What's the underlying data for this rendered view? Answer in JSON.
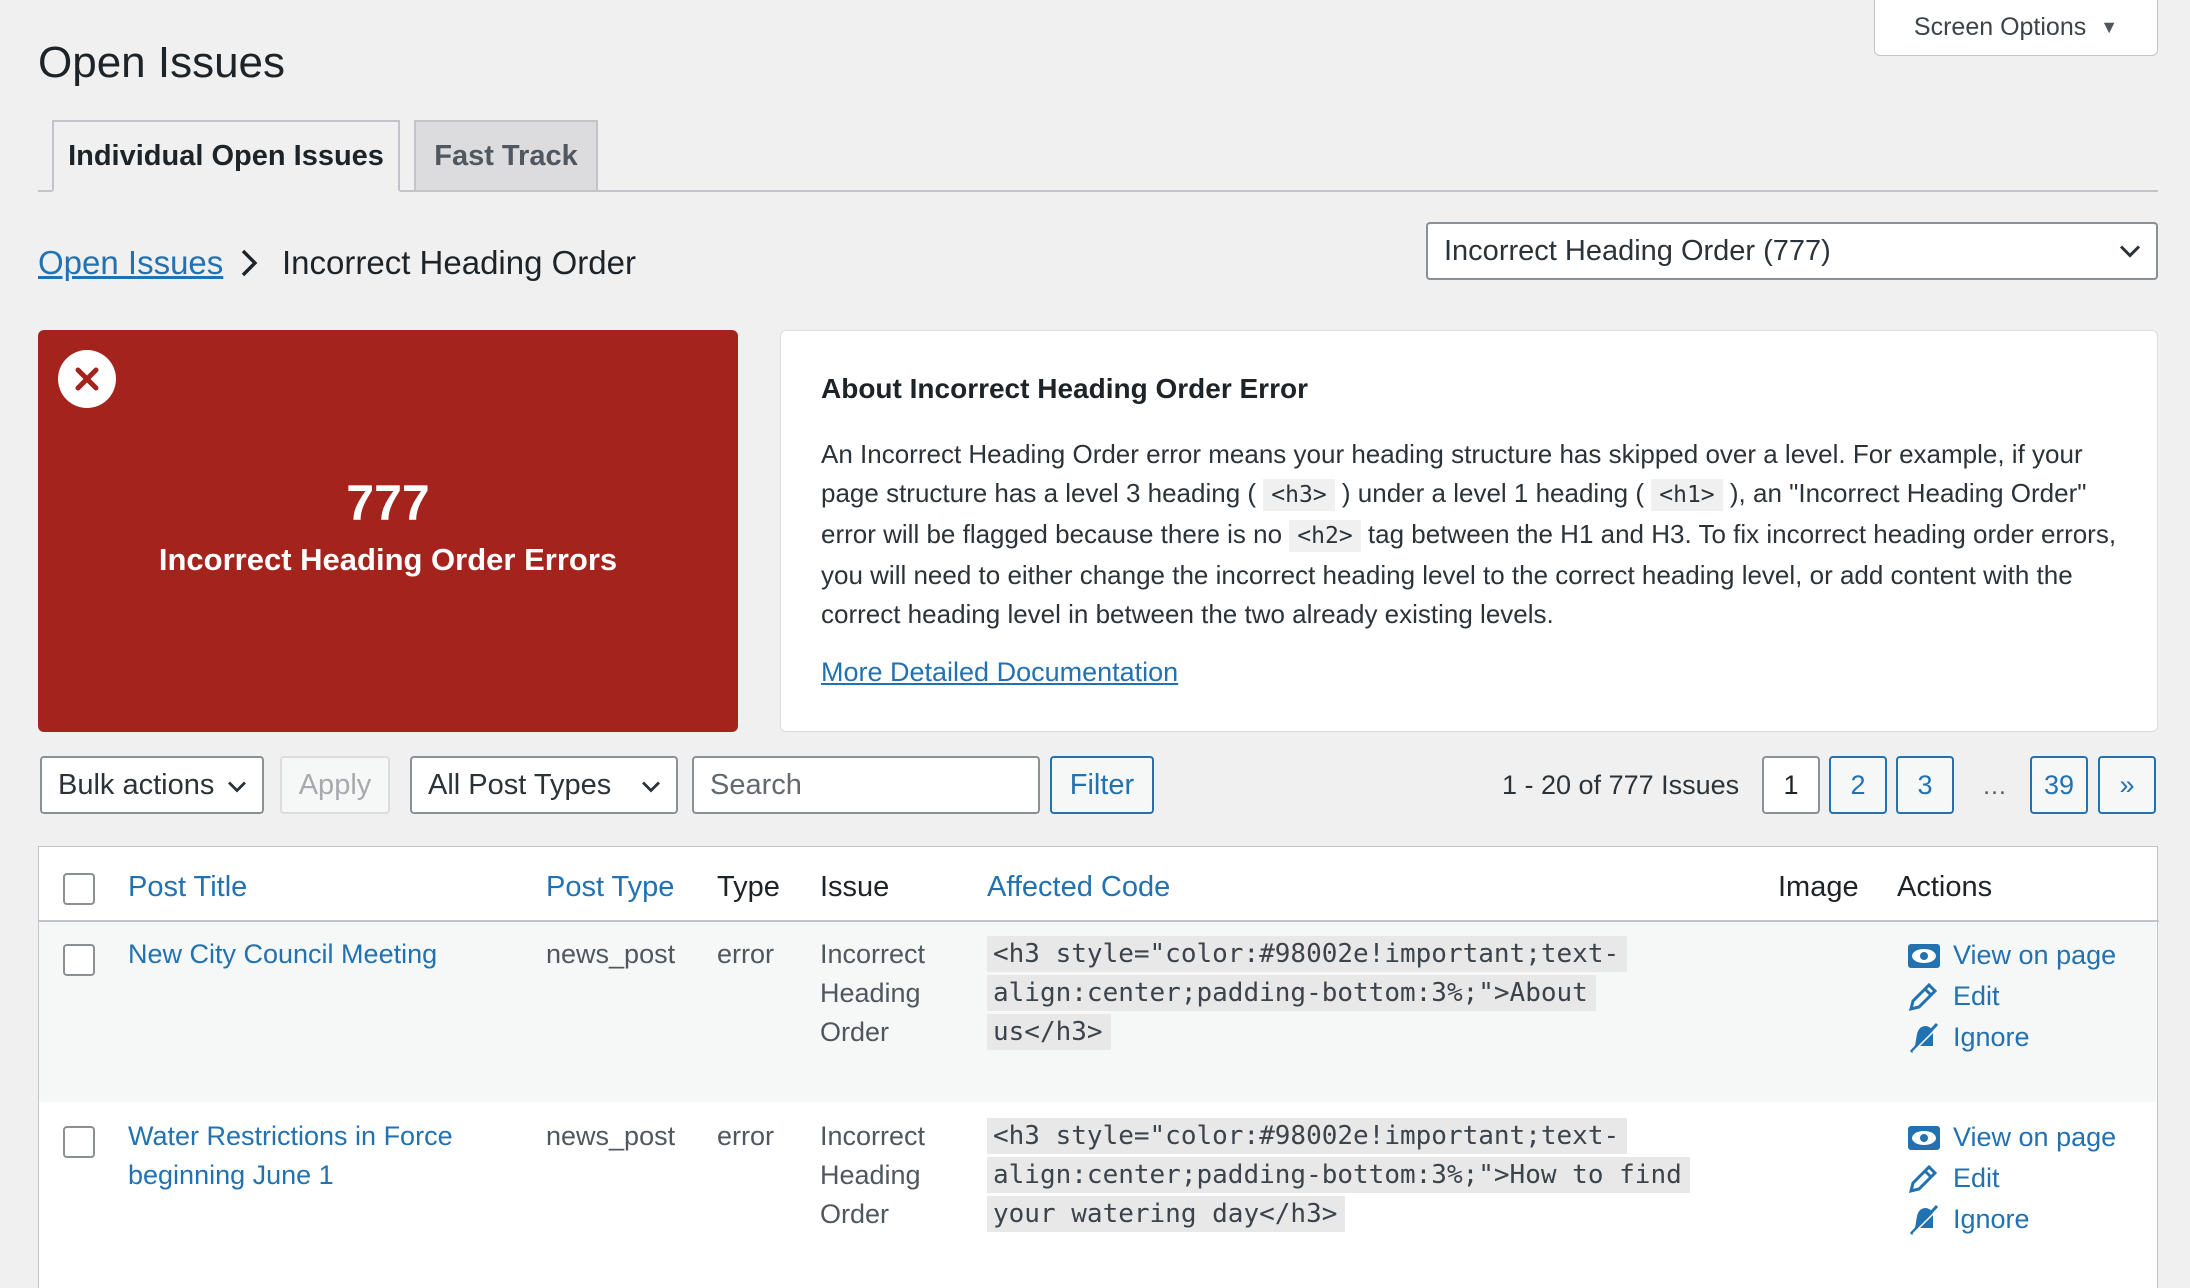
{
  "screen_options": {
    "label": "Screen Options"
  },
  "page": {
    "title": "Open Issues"
  },
  "tabs": [
    {
      "label": "Individual Open Issues",
      "active": true
    },
    {
      "label": "Fast Track",
      "active": false
    }
  ],
  "breadcrumb": {
    "parent": "Open Issues",
    "current": "Incorrect Heading Order"
  },
  "issue_select": {
    "value": "Incorrect Heading Order (777)"
  },
  "summary": {
    "count": "777",
    "label": "Incorrect Heading Order Errors",
    "color": "#a5231d"
  },
  "about": {
    "title": "About Incorrect Heading Order Error",
    "p1": "An Incorrect Heading Order error means your heading structure has skipped over a level. For example, if your page structure has a level 3 heading (",
    "code1": "<h3>",
    "p2": ") under a level 1 heading (",
    "code2": "<h1>",
    "p3": "), an \"Incorrect Heading Order\" error will be flagged because there is no",
    "code3": "<h2>",
    "p4": "tag between the H1 and H3. To fix incorrect heading order errors, you will need to either change the incorrect heading level to the correct heading level, or add content with the correct heading level in between the two already existing levels.",
    "link": "More Detailed Documentation"
  },
  "toolbar": {
    "bulk_actions": "Bulk actions",
    "apply": "Apply",
    "post_types": "All Post Types",
    "search_placeholder": "Search",
    "filter": "Filter",
    "range": "1 - 20 of 777 Issues"
  },
  "pagination": {
    "p1": "1",
    "p2": "2",
    "p3": "3",
    "ellipsis": "…",
    "last": "39",
    "next": "»"
  },
  "table": {
    "headers": {
      "post_title": "Post Title",
      "post_type": "Post Type",
      "type": "Type",
      "issue": "Issue",
      "affected_code": "Affected Code",
      "image": "Image",
      "actions": "Actions"
    },
    "rows": [
      {
        "title": "New City Council Meeting",
        "post_type": "news_post",
        "type": "error",
        "issue": "Incorrect Heading Order",
        "code": "<h3 style=\"color:#98002e!important;text-align:center;padding-bottom:3%;\">About us</h3>",
        "actions": {
          "view": "View on page",
          "edit": "Edit",
          "ignore": "Ignore"
        }
      },
      {
        "title": "Water Restrictions in Force beginning June 1",
        "post_type": "news_post",
        "type": "error",
        "issue": "Incorrect Heading Order",
        "code": "<h3 style=\"color:#98002e!important;text-align:center;padding-bottom:3%;\">How to find your watering day</h3>",
        "actions": {
          "view": "View on page",
          "edit": "Edit",
          "ignore": "Ignore"
        }
      }
    ]
  },
  "colors": {
    "link": "#2271b1",
    "error": "#a5231d",
    "background": "#f0f0f1"
  },
  "icons": {
    "screen_options": "triangle-down-icon",
    "close": "close-circle-icon",
    "view": "eye-icon",
    "edit": "pencil-icon",
    "ignore": "bell-slash-icon"
  }
}
